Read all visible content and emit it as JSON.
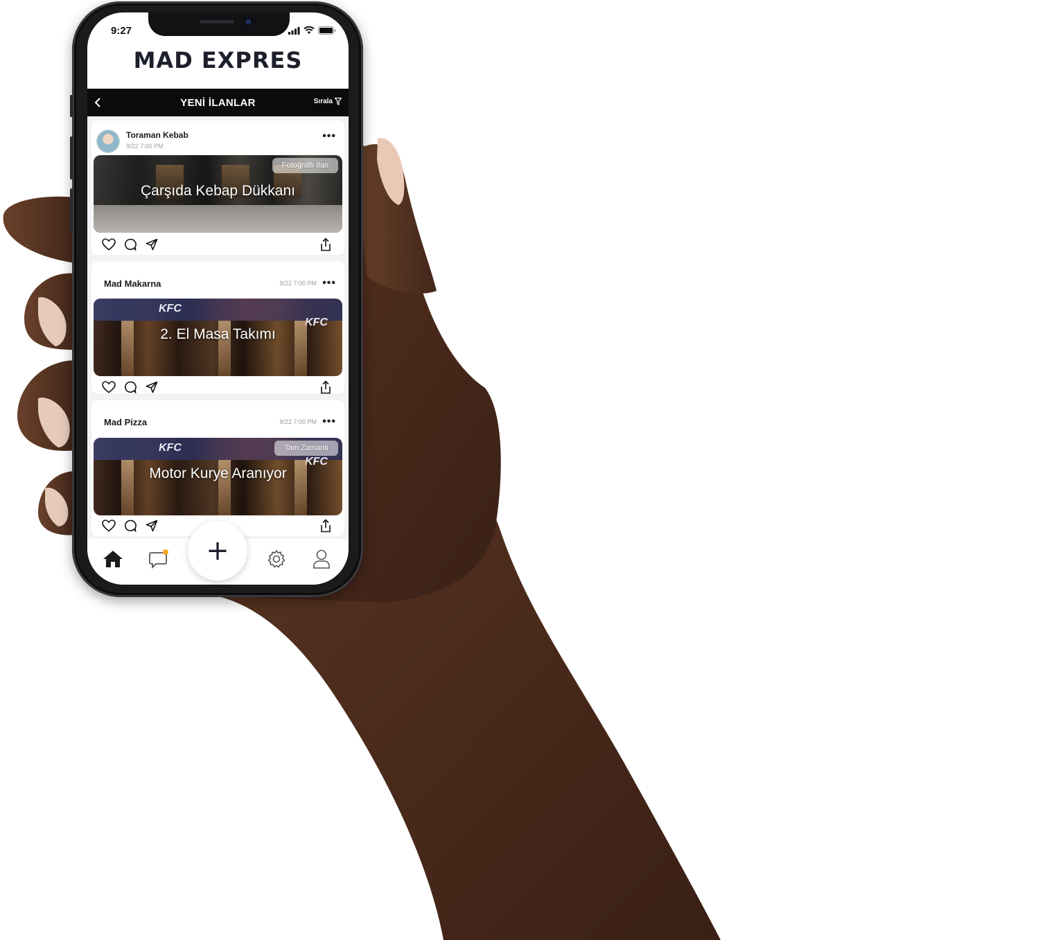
{
  "status_bar": {
    "time": "9:27"
  },
  "app": {
    "brand": "MAD EXPRES"
  },
  "topbar": {
    "title": "YENİ İLANLAR",
    "sort_label": "Sırala"
  },
  "posts": [
    {
      "author": "Toraman Kebab",
      "timestamp": "9/22 7:00 PM",
      "title": "Çarşıda Kebap Dükkanı",
      "tag": "Fotoğraflı İlan"
    },
    {
      "author": "Mad Makarna",
      "timestamp": "9/22 7:00 PM",
      "title": "2. El Masa Takımı",
      "tag": ""
    },
    {
      "author": "Mad Pizza",
      "timestamp": "9/22 7:00 PM",
      "title": "Motor Kurye Aranıyor",
      "tag": "Tam Zamanlı"
    }
  ],
  "post_actions": [
    "heart-icon",
    "comment-icon",
    "send-icon",
    "share-icon"
  ],
  "tabbar": {
    "items": [
      "home-icon",
      "chat-icon",
      "add-icon",
      "settings-icon",
      "profile-icon"
    ],
    "add_label": "+",
    "chat_badge_color": "#f5a623"
  },
  "colors": {
    "header_bg": "#0b0b0c",
    "brand_text": "#1d1f2b",
    "feed_bg": "#f3f3f5"
  }
}
